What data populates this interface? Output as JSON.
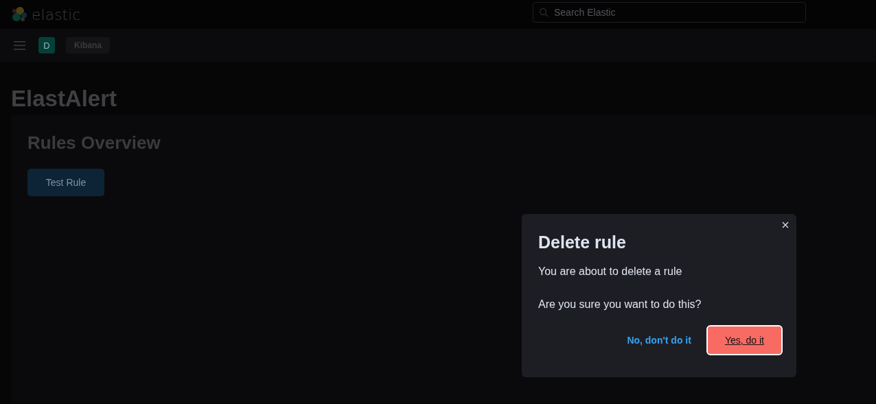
{
  "header": {
    "brand": "elastic",
    "search": {
      "placeholder": "Search Elastic"
    }
  },
  "nav": {
    "space_initial": "D",
    "breadcrumb": "Kibana"
  },
  "page": {
    "title": "ElastAlert",
    "panel": {
      "title": "Rules Overview",
      "buttons": [
        "Test Rule"
      ]
    }
  },
  "modal": {
    "title": "Delete rule",
    "body": [
      "You are about to delete a rule",
      "Are you sure you want to do this?"
    ],
    "buttons": [
      {
        "label": "No, don't do it",
        "kind": "cancel",
        "focused": false
      },
      {
        "label": "Yes, do it",
        "kind": "confirm",
        "focused": true
      }
    ]
  }
}
